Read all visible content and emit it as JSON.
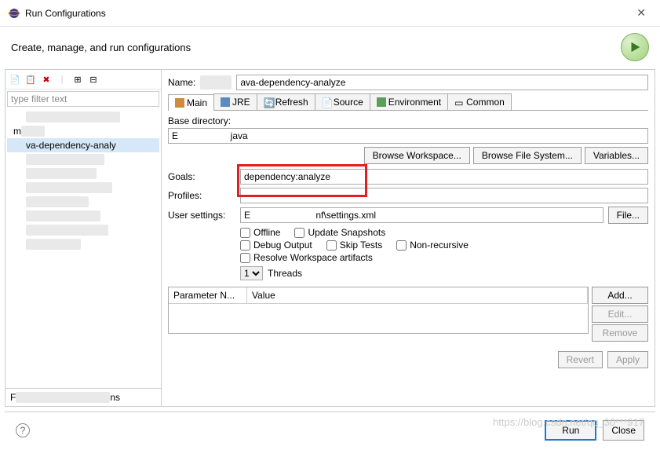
{
  "window": {
    "title": "Run Configurations",
    "subtitle": "Create, manage, and run configurations"
  },
  "left": {
    "filter_placeholder": "type filter text",
    "tree_selected": "va-dependency-analy",
    "tree_prefix": "m"
  },
  "form": {
    "name_label": "Name:",
    "name_value": "ava-dependency-analyze",
    "basedir_label": "Base directory:",
    "basedir_prefix": "E",
    "basedir_suffix": "java",
    "browse_ws": "Browse Workspace...",
    "browse_fs": "Browse File System...",
    "variables": "Variables...",
    "goals_label": "Goals:",
    "goals_value": "dependency:analyze",
    "profiles_label": "Profiles:",
    "profiles_value": "",
    "usersettings_label": "User settings:",
    "usersettings_prefix": "E",
    "usersettings_suffix": "nf\\settings.xml",
    "file_btn": "File...",
    "chk_offline": "Offline",
    "chk_update": "Update Snapshots",
    "chk_debug": "Debug Output",
    "chk_skip": "Skip Tests",
    "chk_nonrec": "Non-recursive",
    "chk_resolve": "Resolve Workspace artifacts",
    "threads_value": "1",
    "threads_label": "Threads",
    "col_param": "Parameter N...",
    "col_value": "Value",
    "add": "Add...",
    "edit": "Edit...",
    "remove": "Remove",
    "revert": "Revert",
    "apply": "Apply"
  },
  "tabs": {
    "main": "Main",
    "jre": "JRE",
    "refresh": "Refresh",
    "source": "Source",
    "env": "Environment",
    "common": "Common"
  },
  "footer": {
    "run": "Run",
    "close": "Close"
  },
  "watermark": "https://blog.csdn.net/qq_30***917"
}
